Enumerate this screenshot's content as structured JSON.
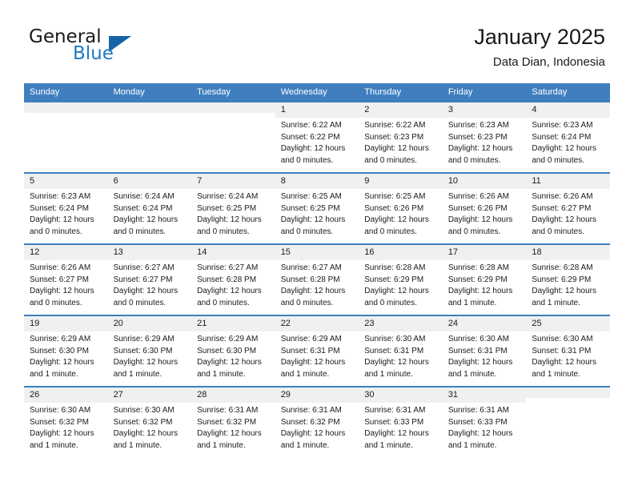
{
  "brand": {
    "line1": "General",
    "line2": "Blue",
    "accent_color": "#1463a8",
    "text_color": "#1a1a1a"
  },
  "header": {
    "title": "January 2025",
    "subtitle": "Data Dian, Indonesia"
  },
  "theme": {
    "header_band": "#3f7fbf",
    "daynum_band": "#f0f0f0",
    "row_rule": "#3f7fbf"
  },
  "weekdays": [
    "Sunday",
    "Monday",
    "Tuesday",
    "Wednesday",
    "Thursday",
    "Friday",
    "Saturday"
  ],
  "weeks": [
    [
      {
        "day": "",
        "sunrise": "",
        "sunset": "",
        "daylight1": "",
        "daylight2": ""
      },
      {
        "day": "",
        "sunrise": "",
        "sunset": "",
        "daylight1": "",
        "daylight2": ""
      },
      {
        "day": "",
        "sunrise": "",
        "sunset": "",
        "daylight1": "",
        "daylight2": ""
      },
      {
        "day": "1",
        "sunrise": "Sunrise: 6:22 AM",
        "sunset": "Sunset: 6:22 PM",
        "daylight1": "Daylight: 12 hours",
        "daylight2": "and 0 minutes."
      },
      {
        "day": "2",
        "sunrise": "Sunrise: 6:22 AM",
        "sunset": "Sunset: 6:23 PM",
        "daylight1": "Daylight: 12 hours",
        "daylight2": "and 0 minutes."
      },
      {
        "day": "3",
        "sunrise": "Sunrise: 6:23 AM",
        "sunset": "Sunset: 6:23 PM",
        "daylight1": "Daylight: 12 hours",
        "daylight2": "and 0 minutes."
      },
      {
        "day": "4",
        "sunrise": "Sunrise: 6:23 AM",
        "sunset": "Sunset: 6:24 PM",
        "daylight1": "Daylight: 12 hours",
        "daylight2": "and 0 minutes."
      }
    ],
    [
      {
        "day": "5",
        "sunrise": "Sunrise: 6:23 AM",
        "sunset": "Sunset: 6:24 PM",
        "daylight1": "Daylight: 12 hours",
        "daylight2": "and 0 minutes."
      },
      {
        "day": "6",
        "sunrise": "Sunrise: 6:24 AM",
        "sunset": "Sunset: 6:24 PM",
        "daylight1": "Daylight: 12 hours",
        "daylight2": "and 0 minutes."
      },
      {
        "day": "7",
        "sunrise": "Sunrise: 6:24 AM",
        "sunset": "Sunset: 6:25 PM",
        "daylight1": "Daylight: 12 hours",
        "daylight2": "and 0 minutes."
      },
      {
        "day": "8",
        "sunrise": "Sunrise: 6:25 AM",
        "sunset": "Sunset: 6:25 PM",
        "daylight1": "Daylight: 12 hours",
        "daylight2": "and 0 minutes."
      },
      {
        "day": "9",
        "sunrise": "Sunrise: 6:25 AM",
        "sunset": "Sunset: 6:26 PM",
        "daylight1": "Daylight: 12 hours",
        "daylight2": "and 0 minutes."
      },
      {
        "day": "10",
        "sunrise": "Sunrise: 6:26 AM",
        "sunset": "Sunset: 6:26 PM",
        "daylight1": "Daylight: 12 hours",
        "daylight2": "and 0 minutes."
      },
      {
        "day": "11",
        "sunrise": "Sunrise: 6:26 AM",
        "sunset": "Sunset: 6:27 PM",
        "daylight1": "Daylight: 12 hours",
        "daylight2": "and 0 minutes."
      }
    ],
    [
      {
        "day": "12",
        "sunrise": "Sunrise: 6:26 AM",
        "sunset": "Sunset: 6:27 PM",
        "daylight1": "Daylight: 12 hours",
        "daylight2": "and 0 minutes."
      },
      {
        "day": "13",
        "sunrise": "Sunrise: 6:27 AM",
        "sunset": "Sunset: 6:27 PM",
        "daylight1": "Daylight: 12 hours",
        "daylight2": "and 0 minutes."
      },
      {
        "day": "14",
        "sunrise": "Sunrise: 6:27 AM",
        "sunset": "Sunset: 6:28 PM",
        "daylight1": "Daylight: 12 hours",
        "daylight2": "and 0 minutes."
      },
      {
        "day": "15",
        "sunrise": "Sunrise: 6:27 AM",
        "sunset": "Sunset: 6:28 PM",
        "daylight1": "Daylight: 12 hours",
        "daylight2": "and 0 minutes."
      },
      {
        "day": "16",
        "sunrise": "Sunrise: 6:28 AM",
        "sunset": "Sunset: 6:29 PM",
        "daylight1": "Daylight: 12 hours",
        "daylight2": "and 0 minutes."
      },
      {
        "day": "17",
        "sunrise": "Sunrise: 6:28 AM",
        "sunset": "Sunset: 6:29 PM",
        "daylight1": "Daylight: 12 hours",
        "daylight2": "and 1 minute."
      },
      {
        "day": "18",
        "sunrise": "Sunrise: 6:28 AM",
        "sunset": "Sunset: 6:29 PM",
        "daylight1": "Daylight: 12 hours",
        "daylight2": "and 1 minute."
      }
    ],
    [
      {
        "day": "19",
        "sunrise": "Sunrise: 6:29 AM",
        "sunset": "Sunset: 6:30 PM",
        "daylight1": "Daylight: 12 hours",
        "daylight2": "and 1 minute."
      },
      {
        "day": "20",
        "sunrise": "Sunrise: 6:29 AM",
        "sunset": "Sunset: 6:30 PM",
        "daylight1": "Daylight: 12 hours",
        "daylight2": "and 1 minute."
      },
      {
        "day": "21",
        "sunrise": "Sunrise: 6:29 AM",
        "sunset": "Sunset: 6:30 PM",
        "daylight1": "Daylight: 12 hours",
        "daylight2": "and 1 minute."
      },
      {
        "day": "22",
        "sunrise": "Sunrise: 6:29 AM",
        "sunset": "Sunset: 6:31 PM",
        "daylight1": "Daylight: 12 hours",
        "daylight2": "and 1 minute."
      },
      {
        "day": "23",
        "sunrise": "Sunrise: 6:30 AM",
        "sunset": "Sunset: 6:31 PM",
        "daylight1": "Daylight: 12 hours",
        "daylight2": "and 1 minute."
      },
      {
        "day": "24",
        "sunrise": "Sunrise: 6:30 AM",
        "sunset": "Sunset: 6:31 PM",
        "daylight1": "Daylight: 12 hours",
        "daylight2": "and 1 minute."
      },
      {
        "day": "25",
        "sunrise": "Sunrise: 6:30 AM",
        "sunset": "Sunset: 6:31 PM",
        "daylight1": "Daylight: 12 hours",
        "daylight2": "and 1 minute."
      }
    ],
    [
      {
        "day": "26",
        "sunrise": "Sunrise: 6:30 AM",
        "sunset": "Sunset: 6:32 PM",
        "daylight1": "Daylight: 12 hours",
        "daylight2": "and 1 minute."
      },
      {
        "day": "27",
        "sunrise": "Sunrise: 6:30 AM",
        "sunset": "Sunset: 6:32 PM",
        "daylight1": "Daylight: 12 hours",
        "daylight2": "and 1 minute."
      },
      {
        "day": "28",
        "sunrise": "Sunrise: 6:31 AM",
        "sunset": "Sunset: 6:32 PM",
        "daylight1": "Daylight: 12 hours",
        "daylight2": "and 1 minute."
      },
      {
        "day": "29",
        "sunrise": "Sunrise: 6:31 AM",
        "sunset": "Sunset: 6:32 PM",
        "daylight1": "Daylight: 12 hours",
        "daylight2": "and 1 minute."
      },
      {
        "day": "30",
        "sunrise": "Sunrise: 6:31 AM",
        "sunset": "Sunset: 6:33 PM",
        "daylight1": "Daylight: 12 hours",
        "daylight2": "and 1 minute."
      },
      {
        "day": "31",
        "sunrise": "Sunrise: 6:31 AM",
        "sunset": "Sunset: 6:33 PM",
        "daylight1": "Daylight: 12 hours",
        "daylight2": "and 1 minute."
      },
      {
        "day": "",
        "sunrise": "",
        "sunset": "",
        "daylight1": "",
        "daylight2": ""
      }
    ]
  ]
}
